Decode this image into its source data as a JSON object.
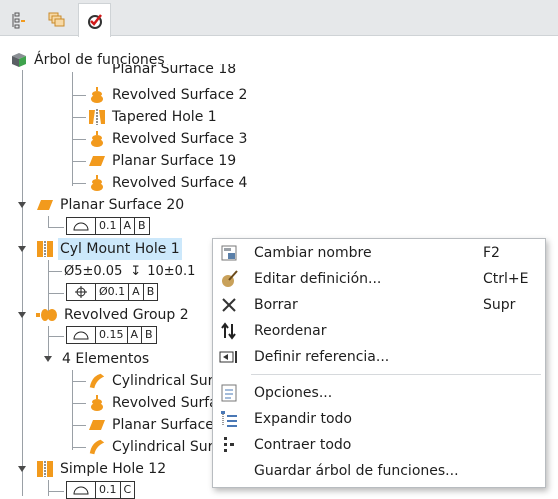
{
  "tabs": [
    {
      "icon": "model-tree-icon"
    },
    {
      "icon": "layers-icon"
    },
    {
      "icon": "features-checklist-icon",
      "active": true
    }
  ],
  "tree": {
    "root_label": "Árbol de funciones",
    "clipped_label": "Planar Surface 18",
    "items": [
      {
        "label": "Revolved Surface 2",
        "icon": "revolved-surface-icon"
      },
      {
        "label": "Tapered Hole 1",
        "icon": "tapered-hole-icon"
      },
      {
        "label": "Revolved Surface 3",
        "icon": "revolved-surface-icon"
      },
      {
        "label": "Planar Surface 19",
        "icon": "planar-surface-icon"
      },
      {
        "label": "Revolved Surface 4",
        "icon": "revolved-surface-icon"
      },
      {
        "label": "Planar Surface 20",
        "icon": "planar-surface-icon"
      },
      {
        "label": "Cyl Mount Hole 1",
        "icon": "hole-icon",
        "selected": true
      },
      {
        "label": "Revolved Group 2",
        "icon": "revolved-group-icon"
      },
      {
        "label": "4 Elementos",
        "icon": ""
      },
      {
        "label": "Cylindrical Surf",
        "icon": "cylindrical-surface-icon"
      },
      {
        "label": "Revolved Surfa",
        "icon": "revolved-surface-icon"
      },
      {
        "label": "Planar Surface",
        "icon": "planar-surface-icon"
      },
      {
        "label": "Cylindrical Surf",
        "icon": "cylindrical-surface-icon"
      },
      {
        "label": "Simple Hole 12",
        "icon": "hole-icon"
      }
    ],
    "gdt": {
      "planar20": {
        "tolerance": "0.1",
        "datums": [
          "A",
          "B"
        ]
      },
      "hole_dims": {
        "diameter": "Ø5±0.05",
        "depth_symbol": "↧",
        "depth": "10±0.1"
      },
      "hole_position": {
        "diameter_mod": "Ø0.1",
        "datums": [
          "A",
          "B"
        ]
      },
      "group2": {
        "tolerance": "0.15",
        "datums": [
          "A",
          "B"
        ]
      },
      "hole12": {
        "tolerance": "0.1",
        "datums": [
          "C"
        ]
      }
    }
  },
  "context_menu": {
    "items": [
      {
        "label": "Cambiar nombre",
        "shortcut": "F2",
        "icon": "rename-icon"
      },
      {
        "label": "Editar definición...",
        "shortcut": "Ctrl+E",
        "icon": "edit-definition-icon"
      },
      {
        "label": "Borrar",
        "shortcut": "Supr",
        "icon": "delete-icon"
      },
      {
        "label": "Reordenar",
        "shortcut": "",
        "icon": "reorder-icon"
      },
      {
        "label": "Definir referencia...",
        "shortcut": "",
        "icon": "define-reference-icon"
      },
      {
        "label": "Opciones...",
        "shortcut": "",
        "icon": "options-icon"
      },
      {
        "label": "Expandir todo",
        "shortcut": "",
        "icon": "expand-all-icon"
      },
      {
        "label": "Contraer todo",
        "shortcut": "",
        "icon": "collapse-all-icon"
      },
      {
        "label": "Guardar árbol de funciones...",
        "shortcut": "",
        "icon": "save-tree-icon"
      }
    ]
  },
  "colors": {
    "selection": "#cce8fb",
    "feature_orange": "#f29a1d",
    "tree_lines": "#9aa0a6"
  }
}
